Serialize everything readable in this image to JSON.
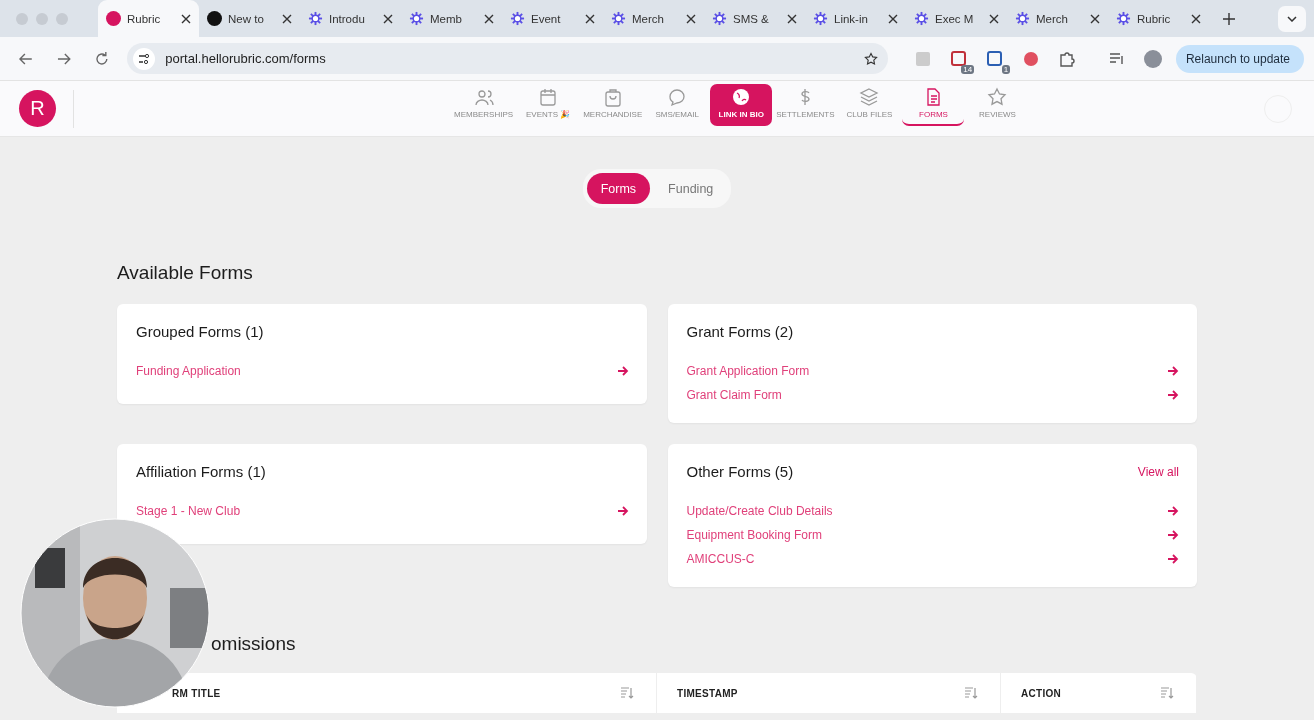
{
  "browser": {
    "tabs": [
      {
        "title": "Rubric",
        "kind": "rubric",
        "selected": true
      },
      {
        "title": "New to",
        "kind": "dark",
        "selected": false
      },
      {
        "title": "Introdu",
        "kind": "spark",
        "selected": false
      },
      {
        "title": "Memb",
        "kind": "spark",
        "selected": false
      },
      {
        "title": "Event",
        "kind": "spark",
        "selected": false
      },
      {
        "title": "Merch",
        "kind": "spark",
        "selected": false
      },
      {
        "title": "SMS &",
        "kind": "spark",
        "selected": false
      },
      {
        "title": "Link-in",
        "kind": "spark",
        "selected": false
      },
      {
        "title": "Exec M",
        "kind": "spark",
        "selected": false
      },
      {
        "title": "Merch",
        "kind": "spark",
        "selected": false
      },
      {
        "title": "Rubric",
        "kind": "spark",
        "selected": false
      }
    ],
    "url": "portal.hellorubric.com/forms",
    "extension_badges": [
      "14",
      "1"
    ],
    "relaunch": "Relaunch to update"
  },
  "app": {
    "logo": "R",
    "nav": [
      {
        "label": "MEMBERSHIPS",
        "selected": false,
        "highlighted": false
      },
      {
        "label": "EVENTS 🎉",
        "selected": false,
        "highlighted": false
      },
      {
        "label": "MERCHANDISE",
        "selected": false,
        "highlighted": false
      },
      {
        "label": "SMS/EMAIL",
        "selected": false,
        "highlighted": false
      },
      {
        "label": "LINK IN BIO",
        "selected": false,
        "highlighted": true
      },
      {
        "label": "SETTLEMENTS",
        "selected": false,
        "highlighted": false
      },
      {
        "label": "CLUB FILES",
        "selected": false,
        "highlighted": false
      },
      {
        "label": "FORMS",
        "selected": true,
        "highlighted": false
      },
      {
        "label": "REVIEWS",
        "selected": false,
        "highlighted": false
      }
    ]
  },
  "segments": [
    {
      "label": "Forms",
      "selected": true
    },
    {
      "label": "Funding",
      "selected": false
    }
  ],
  "available_forms": {
    "heading": "Available Forms",
    "cards": [
      {
        "title": "Grouped Forms (1)",
        "links": [
          "Funding Application"
        ]
      },
      {
        "title": "Grant Forms (2)",
        "links": [
          "Grant Application Form",
          "Grant Claim Form"
        ]
      },
      {
        "title": "Affiliation Forms (1)",
        "links": [
          "Stage 1 - New Club"
        ]
      },
      {
        "title": "Other Forms (5)",
        "view_all": "View all",
        "links": [
          "Update/Create Club Details",
          "Equipment Booking Form",
          "AMICCUS-C"
        ]
      }
    ]
  },
  "submissions": {
    "heading": "omissions",
    "columns": [
      "RM TITLE",
      "TIMESTAMP",
      "ACTION"
    ]
  }
}
